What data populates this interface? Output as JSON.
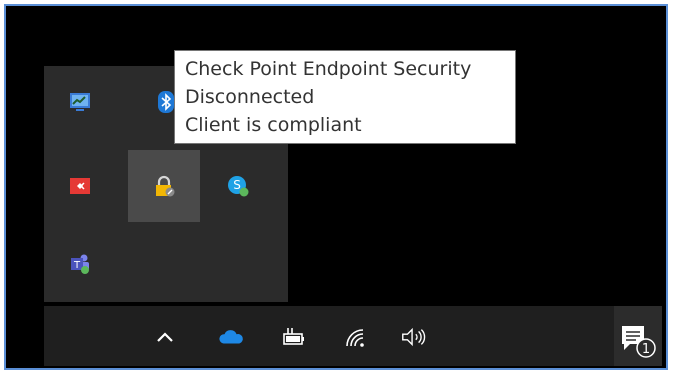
{
  "tooltip": {
    "line1": "Check Point Endpoint Security",
    "line2": "Disconnected",
    "line3": "Client is compliant"
  },
  "tray_overflow": {
    "icons": [
      "network-monitor-icon",
      "bluetooth-icon",
      "remote-access-icon",
      "checkpoint-lock-icon",
      "skype-icon",
      "teams-icon"
    ]
  },
  "taskbar": {
    "icons": [
      "show-hidden-icons-chevron-icon",
      "onedrive-cloud-icon",
      "battery-power-icon",
      "wifi-icon",
      "volume-icon"
    ]
  },
  "action_center": {
    "badge_count": "1",
    "icon": "notification-icon"
  },
  "colors": {
    "tray_bg": "#2b2b2b",
    "taskbar_bg": "#1f1f1f",
    "hover_bg": "#4a4a4a",
    "frame_border": "#5b8fd6"
  }
}
